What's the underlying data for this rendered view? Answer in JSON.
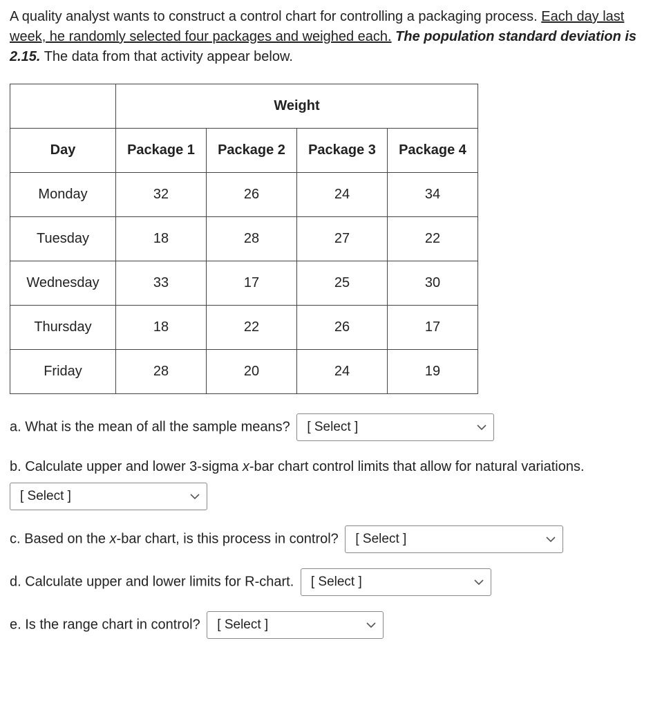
{
  "intro": {
    "p1a": "A quality analyst wants to construct a control chart for controlling a packaging process.  ",
    "p1b": "Each day last week, he randomly selected four packages and weighed each.",
    "p1c": " ",
    "p1d": "The population standard deviation is 2.15.",
    "p1e": " The data from that activity appear below."
  },
  "table": {
    "weight_header": "Weight",
    "col_day": "Day",
    "col_p1": "Package 1",
    "col_p2": "Package 2",
    "col_p3": "Package 3",
    "col_p4": "Package 4",
    "rows": [
      {
        "day": "Monday",
        "p1": "32",
        "p2": "26",
        "p3": "24",
        "p4": "34"
      },
      {
        "day": "Tuesday",
        "p1": "18",
        "p2": "28",
        "p3": "27",
        "p4": "22"
      },
      {
        "day": "Wednesday",
        "p1": "33",
        "p2": "17",
        "p3": "25",
        "p4": "30"
      },
      {
        "day": "Thursday",
        "p1": "18",
        "p2": "22",
        "p3": "26",
        "p4": "17"
      },
      {
        "day": "Friday",
        "p1": "28",
        "p2": "20",
        "p3": "24",
        "p4": "19"
      }
    ]
  },
  "questions": {
    "a": "a. What is the mean of all the sample means?",
    "b_pre": "b. Calculate upper and lower 3-sigma ",
    "b_x": "x",
    "b_post": "-bar chart control limits that allow for natural variations.",
    "c_pre": "c. Based on the ",
    "c_x": "x",
    "c_post": "-bar chart, is this process in control?",
    "d": "d. Calculate upper and lower limits for R-chart.",
    "e": "e. Is the range chart in control?"
  },
  "select_placeholder": "[ Select ]"
}
